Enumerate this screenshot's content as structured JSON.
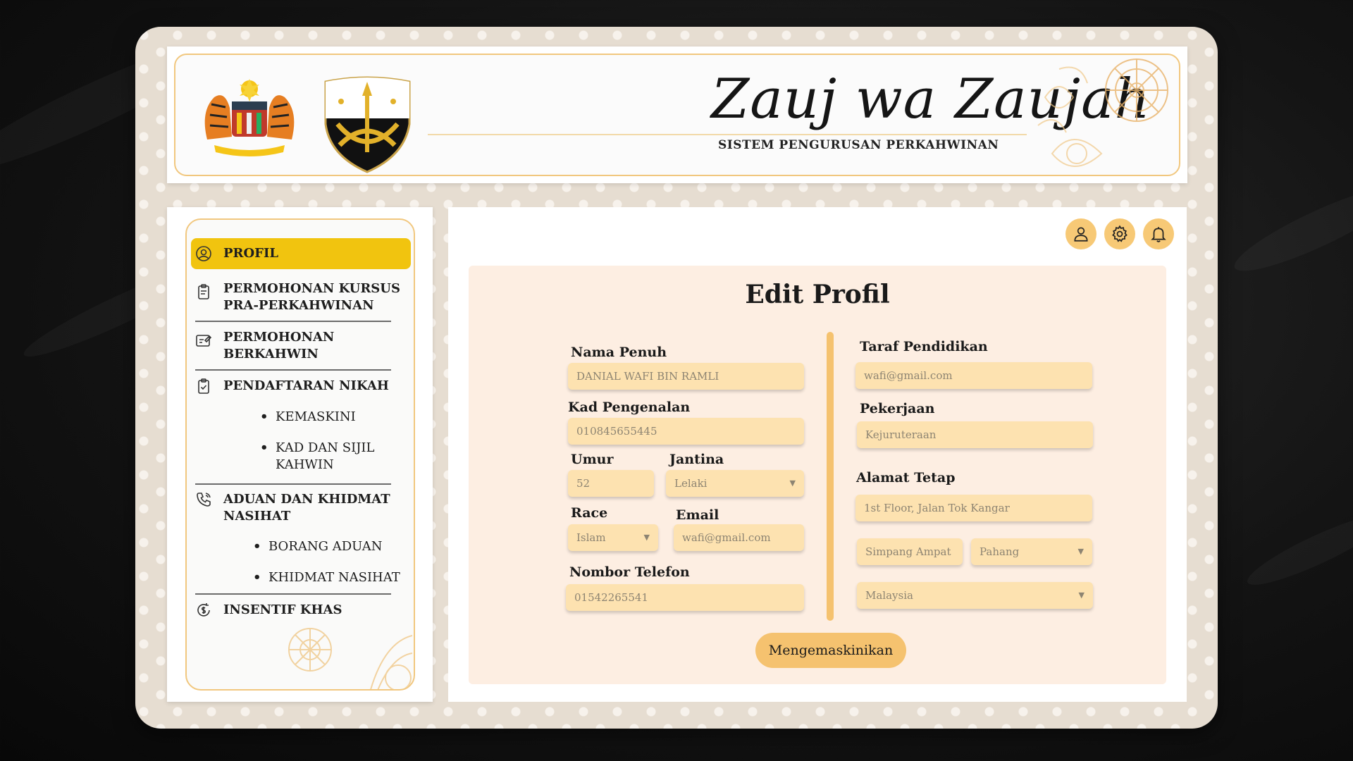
{
  "header": {
    "title": "Zauj wa Zaujah",
    "subtitle": "SISTEM PENGURUSAN PERKAHWINAN"
  },
  "sidebar": {
    "items": [
      {
        "label": "PROFIL",
        "icon": "user-circle-icon",
        "active": true
      },
      {
        "label": "PERMOHONAN KURSUS",
        "label2": "PRA-PERKAHWINAN",
        "icon": "clipboard-icon"
      },
      {
        "label": "PERMOHONAN",
        "label2": "BERKAHWIN",
        "icon": "form-edit-icon"
      },
      {
        "label": "PENDAFTARAN NIKAH",
        "icon": "clipboard-check-icon"
      },
      {
        "label": "ADUAN DAN KHIDMAT",
        "label2": "NASIHAT",
        "icon": "phone-icon"
      },
      {
        "label": "INSENTIF KHAS",
        "icon": "dollar-cycle-icon"
      }
    ],
    "subitems": {
      "kemaskini": "KEMASKINI",
      "kad_line1": "KAD DAN SIJIL",
      "kad_line2": "KAHWIN",
      "borang_aduan": "BORANG ADUAN",
      "khidmat_nasihat": "KHIDMAT NASIHAT"
    },
    "bullet": "•"
  },
  "topbar": {
    "icons": [
      "user-icon",
      "gear-icon",
      "bell-icon"
    ],
    "accent": "#f7c976"
  },
  "form": {
    "title": "Edit Profil",
    "labels": {
      "nama": "Nama Penuh",
      "kad": "Kad Pengenalan",
      "umur": "Umur",
      "jantina": "Jantina",
      "race": "Race",
      "email": "Email",
      "telefon": "Nombor Telefon",
      "taraf": "Taraf Pendidikan",
      "pekerjaan": "Pekerjaan",
      "alamat": "Alamat Tetap"
    },
    "values": {
      "nama": "DANIAL WAFI BIN RAMLI",
      "kad": "010845655445",
      "umur": "52",
      "jantina": "Lelaki",
      "race": "Islam",
      "email": "wafi@gmail.com",
      "telefon": "01542265541",
      "taraf": "wafi@gmail.com",
      "pekerjaan": "Kejuruteraan",
      "alamat1": "1st Floor, Jalan Tok Kangar",
      "bandar": "Simpang Ampat",
      "negeri": "Pahang",
      "negara": "Malaysia"
    },
    "chevron": "▼",
    "submit": "Mengemaskinikan"
  },
  "colors": {
    "accent_yellow": "#f1c40f",
    "field_bg": "#fde2b0",
    "card_bg": "#fdeee2",
    "button": "#f5c26f",
    "border_gold": "#f1c77e"
  }
}
